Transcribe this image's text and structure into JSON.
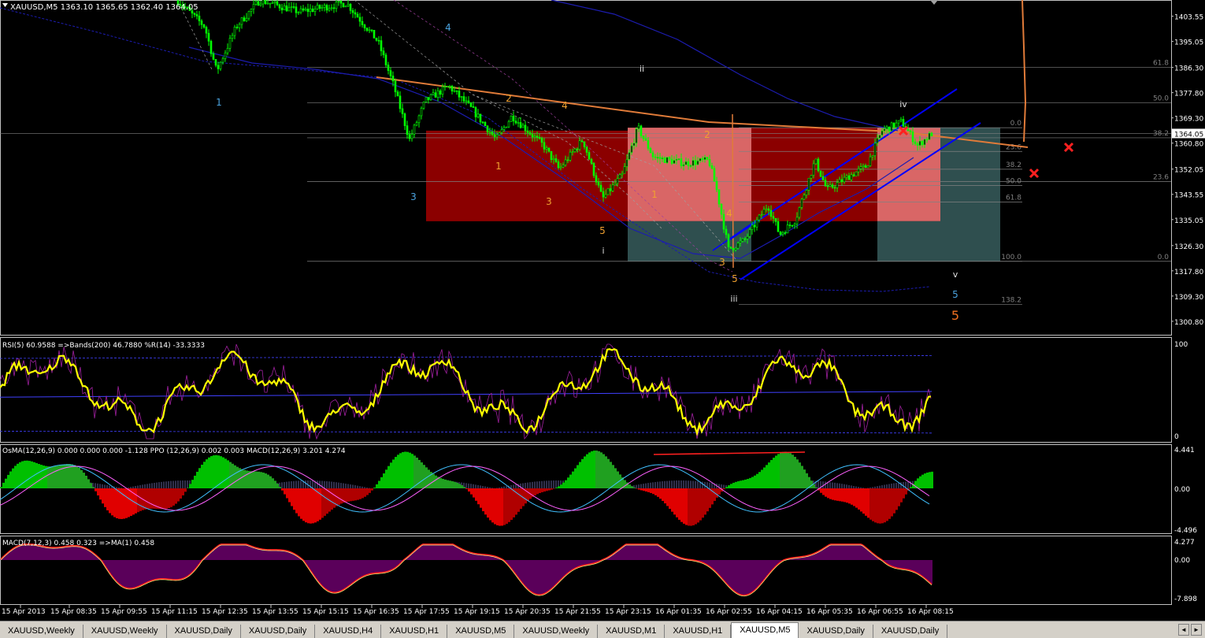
{
  "main_pane": {
    "title": "XAUUSD,M5  1363.10 1365.65 1362.40 1364.05",
    "price_labels": [
      "1403.55",
      "1395.05",
      "1386.30",
      "1377.80",
      "1369.30",
      "1360.80",
      "1352.05",
      "1343.55",
      "1335.05",
      "1326.30",
      "1317.80",
      "1309.30",
      "1300.80"
    ],
    "current_price": "1364.05",
    "elliott_labels": {
      "blue": [
        "1",
        "3",
        "4"
      ],
      "white": [
        "ii",
        "iv",
        "i",
        "iii",
        "v"
      ],
      "orange": [
        "2",
        "4",
        "1",
        "3",
        "5",
        "2",
        "1",
        "4",
        "3",
        "5"
      ],
      "wave5_blue": "5",
      "wave5_orange": "5"
    },
    "fib_left": [
      "61.8",
      "50.0",
      "38.2",
      "23.6",
      "0.0"
    ],
    "fib_right": [
      "0.0",
      "23.6",
      "38.2",
      "50.0",
      "61.8",
      "100.0",
      "138.2"
    ]
  },
  "rsi_pane": {
    "title": "RSI(5) 60.9588  =>Bands(200) 46.7880  %R(14) -33.3333",
    "scale": [
      "100",
      "0"
    ]
  },
  "osma_pane": {
    "title": "OsMA(12,26,9) 0.000 0.000 0.000 -1.128  PPO (12,26,9) 0.002 0.003  MACD(12,26,9) 3.201 4.274",
    "scale": [
      "4.441",
      "0.00",
      "-4.496"
    ]
  },
  "macd_pane": {
    "title": "MACD(7,12,3) 0.458 0.323  =>MA(1) 0.458",
    "scale": [
      "4.277",
      "0.00",
      "-7.898"
    ]
  },
  "time_axis": [
    "15 Apr 2013",
    "15 Apr 08:35",
    "15 Apr 09:55",
    "15 Apr 11:15",
    "15 Apr 12:35",
    "15 Apr 13:55",
    "15 Apr 15:15",
    "15 Apr 16:35",
    "15 Apr 17:55",
    "15 Apr 19:15",
    "15 Apr 20:35",
    "15 Apr 21:55",
    "15 Apr 23:15",
    "16 Apr 01:35",
    "16 Apr 02:55",
    "16 Apr 04:15",
    "16 Apr 05:35",
    "16 Apr 06:55",
    "16 Apr 08:15"
  ],
  "tabs": [
    {
      "label": "XAUUSD,Weekly",
      "active": false
    },
    {
      "label": "XAUUSD,Weekly",
      "active": false
    },
    {
      "label": "XAUUSD,Daily",
      "active": false
    },
    {
      "label": "XAUUSD,Daily",
      "active": false
    },
    {
      "label": "XAUUSD,H4",
      "active": false
    },
    {
      "label": "XAUUSD,H1",
      "active": false
    },
    {
      "label": "XAUUSD,M5",
      "active": false
    },
    {
      "label": "XAUUSD,Weekly",
      "active": false
    },
    {
      "label": "XAUUSD,M1",
      "active": false
    },
    {
      "label": "XAUUSD,H1",
      "active": false
    },
    {
      "label": "XAUUSD,M5",
      "active": true
    },
    {
      "label": "XAUUSD,Daily",
      "active": false
    },
    {
      "label": "XAUUSD,Daily",
      "active": false
    }
  ],
  "colors": {
    "up_candle": "#00ff00",
    "down_candle": "#00ff00",
    "rsi": "#ffff00",
    "band": "#4040ff",
    "zone_red": "#8b0000",
    "zone_pink": "#d96666",
    "zone_teal": "#2f4f4f",
    "channel": "#0000ff",
    "trend": "#e07b39",
    "hist_up": "#00c000",
    "hist_down": "#e00000",
    "macd_hist": "#800080"
  }
}
